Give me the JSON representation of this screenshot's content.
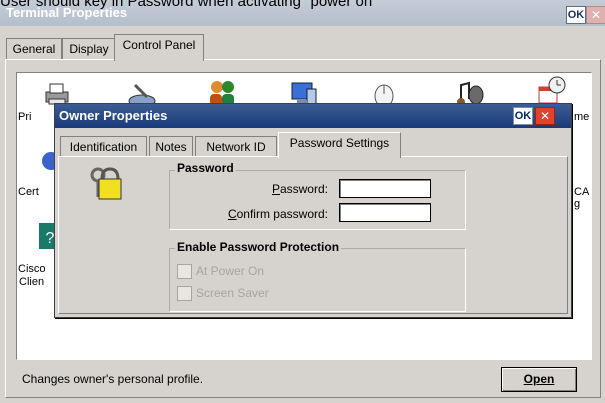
{
  "caption": "User should key in Password when activating \"power on\"",
  "outer_window": {
    "title": "Terminal Properties",
    "ok_label": "OK",
    "close_label": "✕",
    "tabs": [
      {
        "label": "General",
        "active": false
      },
      {
        "label": "Display",
        "active": false
      },
      {
        "label": "Control Panel",
        "active": true
      }
    ]
  },
  "control_panel": {
    "icons": [
      {
        "name": "printer-icon",
        "label": "Pri"
      },
      {
        "name": "stylus-icon",
        "label": ""
      },
      {
        "name": "owner-icon",
        "label": ""
      },
      {
        "name": "network-icon",
        "label": ""
      },
      {
        "name": "mouse-icon",
        "label": ""
      },
      {
        "name": "volume-icon",
        "label": ""
      },
      {
        "name": "date-time-icon",
        "label": "me"
      },
      {
        "name": "certificates-icon",
        "label": "Cert"
      },
      {
        "name": "ica-icon",
        "label": "CA",
        "label2": "g"
      },
      {
        "name": "cisco-icon",
        "label": "Cisco",
        "label2": "Clien"
      }
    ]
  },
  "status_bar": {
    "text": "Changes owner's personal profile."
  },
  "open_button": {
    "label": "Open"
  },
  "dialog": {
    "title": "Owner Properties",
    "ok_label": "OK",
    "close_label": "✕",
    "tabs": [
      {
        "label": "Identification",
        "active": false
      },
      {
        "label": "Notes",
        "active": false
      },
      {
        "label": "Network ID",
        "active": false
      },
      {
        "label": "Password Settings",
        "active": true
      }
    ],
    "password_group": {
      "title": "Password",
      "password_label": "Password:",
      "confirm_label": "Confirm password:",
      "password_value": "",
      "confirm_value": ""
    },
    "protection_group": {
      "title": "Enable Password Protection",
      "at_power_on": {
        "label": "At Power On",
        "checked": false,
        "enabled": false
      },
      "screen_saver": {
        "label": "Screen Saver",
        "checked": false,
        "enabled": false
      }
    }
  }
}
